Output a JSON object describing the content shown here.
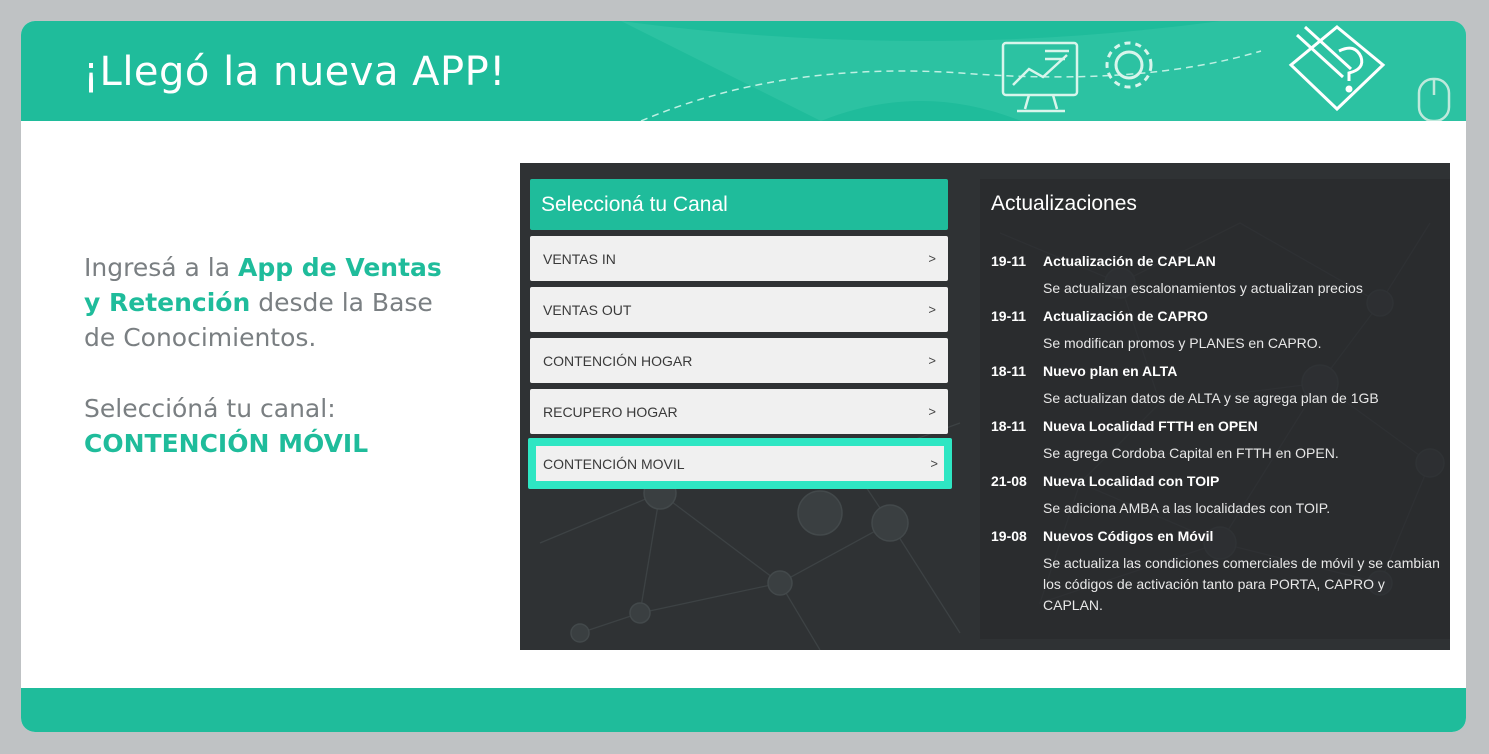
{
  "header": {
    "title": "¡Llegó la nueva APP!"
  },
  "intro": {
    "line1_pre": "Ingresá a la ",
    "line1_highlight": "App de Ventas y Retención",
    "line1_post": " desde la Base de Conocimientos.",
    "line2": "Seleccióná tu canal:",
    "line2_highlight": "CONTENCIÓN MÓVIL"
  },
  "app": {
    "canal_title": "Seleccioná tu Canal",
    "channels": [
      {
        "label": "VENTAS IN",
        "chevron": ">"
      },
      {
        "label": "VENTAS OUT",
        "chevron": ">"
      },
      {
        "label": "CONTENCIÓN HOGAR",
        "chevron": ">"
      },
      {
        "label": "RECUPERO HOGAR",
        "chevron": ">"
      },
      {
        "label": "CONTENCIÓN MOVIL",
        "chevron": ">",
        "selected": true
      }
    ],
    "updates_title": "Actualizaciones",
    "updates": [
      {
        "date": "19-11",
        "title": "Actualización de CAPLAN",
        "desc": "Se actualizan escalonamientos y actualizan precios"
      },
      {
        "date": "19-11",
        "title": "Actualización de CAPRO",
        "desc": "Se modifican promos y PLANES en CAPRO."
      },
      {
        "date": "18-11",
        "title": "Nuevo plan en ALTA",
        "desc": "Se actualizan datos de ALTA y se agrega plan de 1GB"
      },
      {
        "date": "18-11",
        "title": "Nueva Localidad FTTH en OPEN",
        "desc": "Se agrega Cordoba Capital en FTTH en OPEN."
      },
      {
        "date": "21-08",
        "title": "Nueva Localidad con TOIP",
        "desc": "Se adiciona AMBA a las localidades con TOIP."
      },
      {
        "date": "19-08",
        "title": "Nuevos Códigos en Móvil",
        "desc": "Se actualiza las condiciones comerciales de móvil y se cambian los códigos de activación tanto para PORTA, CAPRO y CAPLAN."
      }
    ]
  },
  "colors": {
    "accent": "#1fbc9b",
    "highlight_border": "#2ee6c3",
    "app_bg": "#2f3234"
  },
  "icons": [
    "monitor-chart-icon",
    "gear-icon",
    "mouse-icon",
    "pencil-question-icon"
  ]
}
